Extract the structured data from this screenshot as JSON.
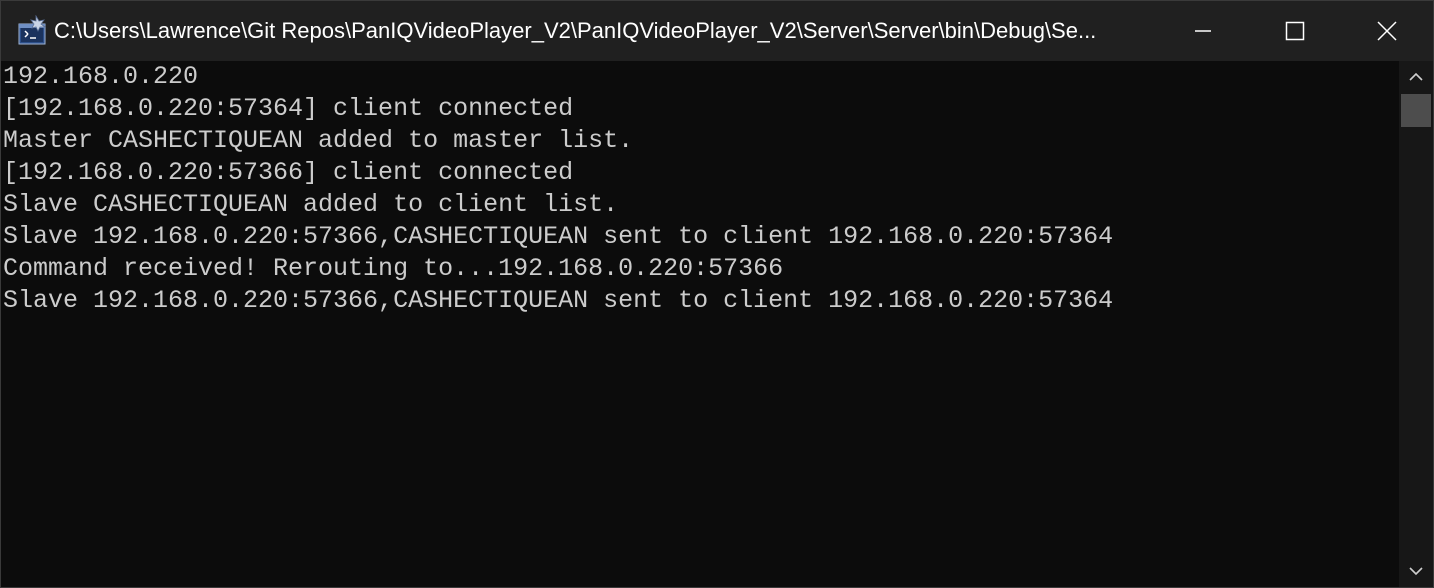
{
  "window": {
    "title": "C:\\Users\\Lawrence\\Git Repos\\PanIQVideoPlayer_V2\\PanIQVideoPlayer_V2\\Server\\Server\\bin\\Debug\\Se...",
    "icon": "console-app-icon",
    "controls": {
      "minimize": "minimize-icon",
      "maximize": "maximize-icon",
      "close": "close-icon"
    }
  },
  "console": {
    "lines": [
      "192.168.0.220",
      "[192.168.0.220:57364] client connected",
      "Master CASHECTIQUEAN added to master list.",
      "[192.168.0.220:57366] client connected",
      "Slave CASHECTIQUEAN added to client list.",
      "Slave 192.168.0.220:57366,CASHECTIQUEAN sent to client 192.168.0.220:57364",
      "Command received! Rerouting to...192.168.0.220:57366",
      "Slave 192.168.0.220:57366,CASHECTIQUEAN sent to client 192.168.0.220:57364"
    ]
  },
  "colors": {
    "titlebar": "#202020",
    "console_bg": "#0c0c0c",
    "console_text": "#cccccc",
    "scrollbar_track": "#171717",
    "scrollbar_thumb": "#4d4d4d"
  }
}
